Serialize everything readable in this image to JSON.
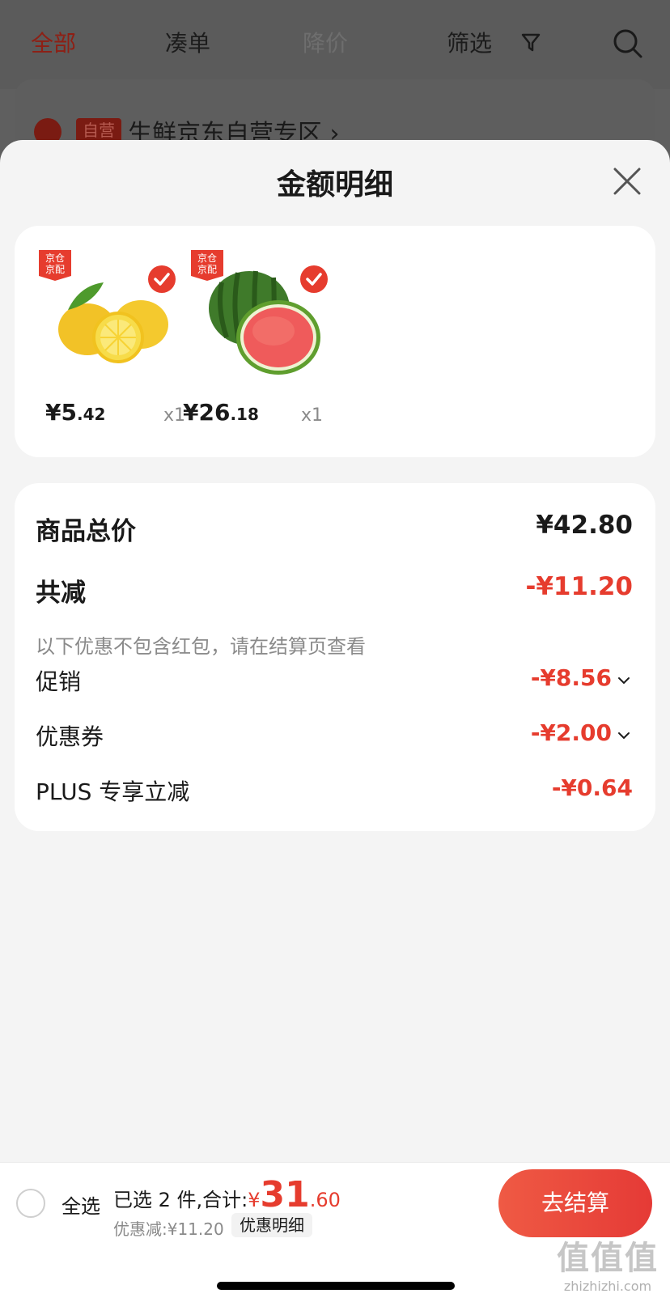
{
  "background": {
    "tabs": [
      {
        "label": "全部",
        "active": true
      },
      {
        "label": "凑单",
        "active": false
      },
      {
        "label": "降价",
        "active": false
      },
      {
        "label": "筛选",
        "active": false
      }
    ],
    "shop": {
      "badge": "自营",
      "name": "生鲜京东自营专区",
      "arrow": "›"
    }
  },
  "sheet": {
    "title": "金额明细",
    "products": [
      {
        "badge_line1": "京仓",
        "badge_line2": "京配",
        "image_icon": "lemon",
        "price_symbol": "¥",
        "price_int": "5",
        "price_dec": ".42",
        "qty": "x1"
      },
      {
        "badge_line1": "京仓",
        "badge_line2": "京配",
        "image_icon": "watermelon",
        "price_symbol": "¥",
        "price_int": "26",
        "price_dec": ".18",
        "qty": "x1"
      }
    ],
    "details": {
      "total_label": "商品总价",
      "total_value": "¥42.80",
      "reduce_label": "共减",
      "reduce_value": "-¥11.20",
      "note": "以下优惠不包含红包，请在结算页查看",
      "promo_label": "促销",
      "promo_value": "-¥8.56",
      "coupon_label": "优惠券",
      "coupon_value": "-¥2.00",
      "plus_label": "PLUS 专享立减",
      "plus_value": "-¥0.64"
    }
  },
  "bottom_bar": {
    "select_all": "全选",
    "selected_text": "已选 2 件,合计:",
    "total_symbol": "¥",
    "total_int": "31",
    "total_dec": ".60",
    "discount_text": "优惠减:¥11.20",
    "discount_detail": "优惠明细",
    "checkout": "去结算"
  },
  "watermark": {
    "glyphs": "值值值",
    "url": "zhizhizhi.com"
  },
  "colors": {
    "accent": "#e63c2e",
    "dim_overlay": "#5f5f5f",
    "sheet_bg": "#f4f4f4"
  }
}
